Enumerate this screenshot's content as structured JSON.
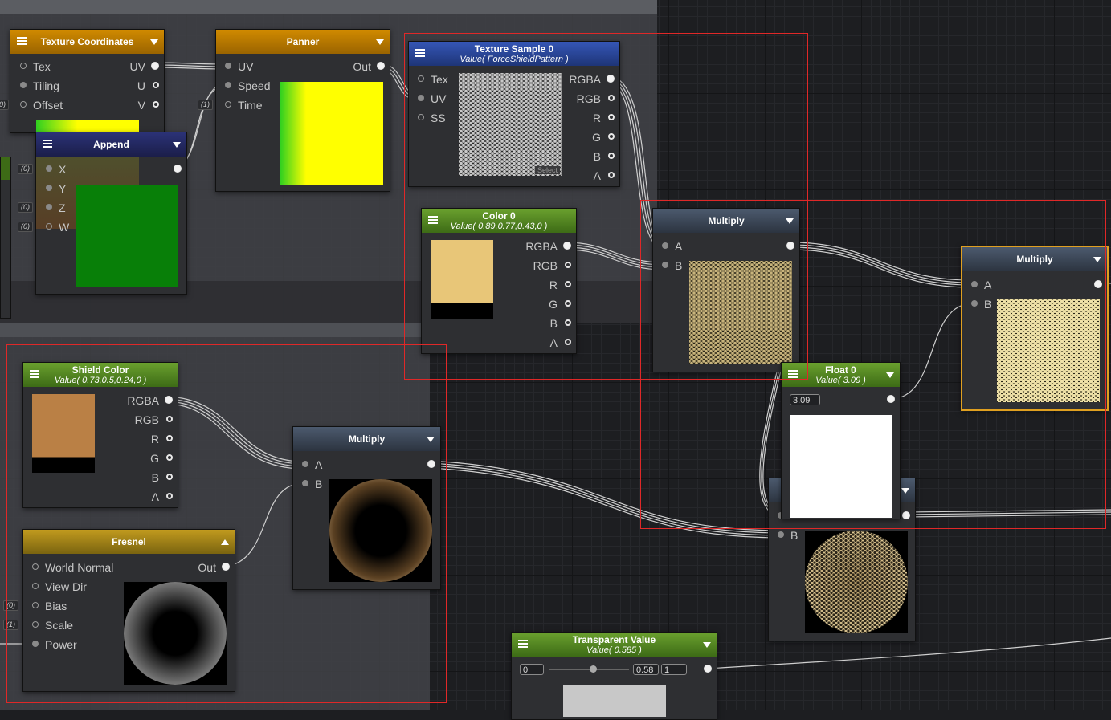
{
  "nodes": {
    "texcoord": {
      "title": "Texture Coordinates",
      "inputs": [
        "Tex",
        "Tiling",
        "Offset"
      ],
      "outputs": [
        "UV",
        "U",
        "V"
      ]
    },
    "panner": {
      "title": "Panner",
      "inputs": [
        "UV",
        "Speed",
        "Time"
      ],
      "output": "Out"
    },
    "append": {
      "title": "Append",
      "inputs": [
        "X",
        "Y",
        "Z",
        "W"
      ]
    },
    "texsample": {
      "title": "Texture Sample 0",
      "subtitle": "Value( ForceShieldPattern )",
      "inputs": [
        "Tex",
        "UV",
        "SS"
      ],
      "outputs": [
        "RGBA",
        "RGB",
        "R",
        "G",
        "B",
        "A"
      ],
      "select_label": "Select"
    },
    "color0": {
      "title": "Color 0",
      "subtitle": "Value( 0.89,0.77,0.43,0 )",
      "outputs": [
        "RGBA",
        "RGB",
        "R",
        "G",
        "B",
        "A"
      ],
      "swatch": "#e8c678"
    },
    "multiply1": {
      "title": "Multiply",
      "inputs": [
        "A",
        "B"
      ]
    },
    "multiply2": {
      "title": "Multiply",
      "inputs": [
        "A",
        "B"
      ]
    },
    "float0": {
      "title": "Float 0",
      "subtitle": "Value( 3.09 )",
      "value": "3.09"
    },
    "shield": {
      "title": "Shield Color",
      "subtitle": "Value( 0.73,0.5,0.24,0 )",
      "outputs": [
        "RGBA",
        "RGB",
        "R",
        "G",
        "B",
        "A"
      ],
      "swatch": "#ba8045"
    },
    "multiply3": {
      "title": "Multiply",
      "inputs": [
        "A",
        "B"
      ]
    },
    "fresnel": {
      "title": "Fresnel",
      "inputs": [
        "World Normal",
        "View Dir",
        "Bias",
        "Scale",
        "Power"
      ],
      "output": "Out"
    },
    "multiply4": {
      "inputs": [
        "B"
      ]
    },
    "transparent": {
      "title": "Transparent Value",
      "subtitle": "Value( 0.585 )",
      "min": "0",
      "current": "0.58",
      "max": "1"
    }
  },
  "side_tags": [
    "(0)",
    "(0)",
    "(0)",
    "(0)",
    "(1)",
    "(0)",
    "(1)"
  ],
  "colors": {
    "selected": "#e0a020",
    "selection_rect": "#e02828"
  }
}
